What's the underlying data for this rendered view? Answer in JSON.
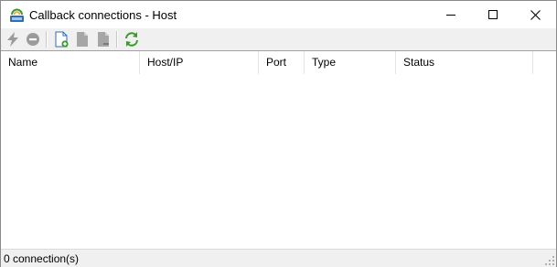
{
  "window": {
    "title": "Callback connections - Host"
  },
  "toolbar": {
    "icons": [
      "connect-icon",
      "disconnect-icon",
      "new-connection-icon",
      "edit-connection-icon",
      "delete-connection-icon",
      "refresh-icon"
    ]
  },
  "list": {
    "columns": [
      "Name",
      "Host/IP",
      "Port",
      "Type",
      "Status"
    ],
    "rows": []
  },
  "status": {
    "text": "0 connection(s)"
  },
  "colors": {
    "accent_green": "#3c9a2e",
    "disabled_gray": "#9b9b9b",
    "icon_blue": "#2f6db5"
  }
}
